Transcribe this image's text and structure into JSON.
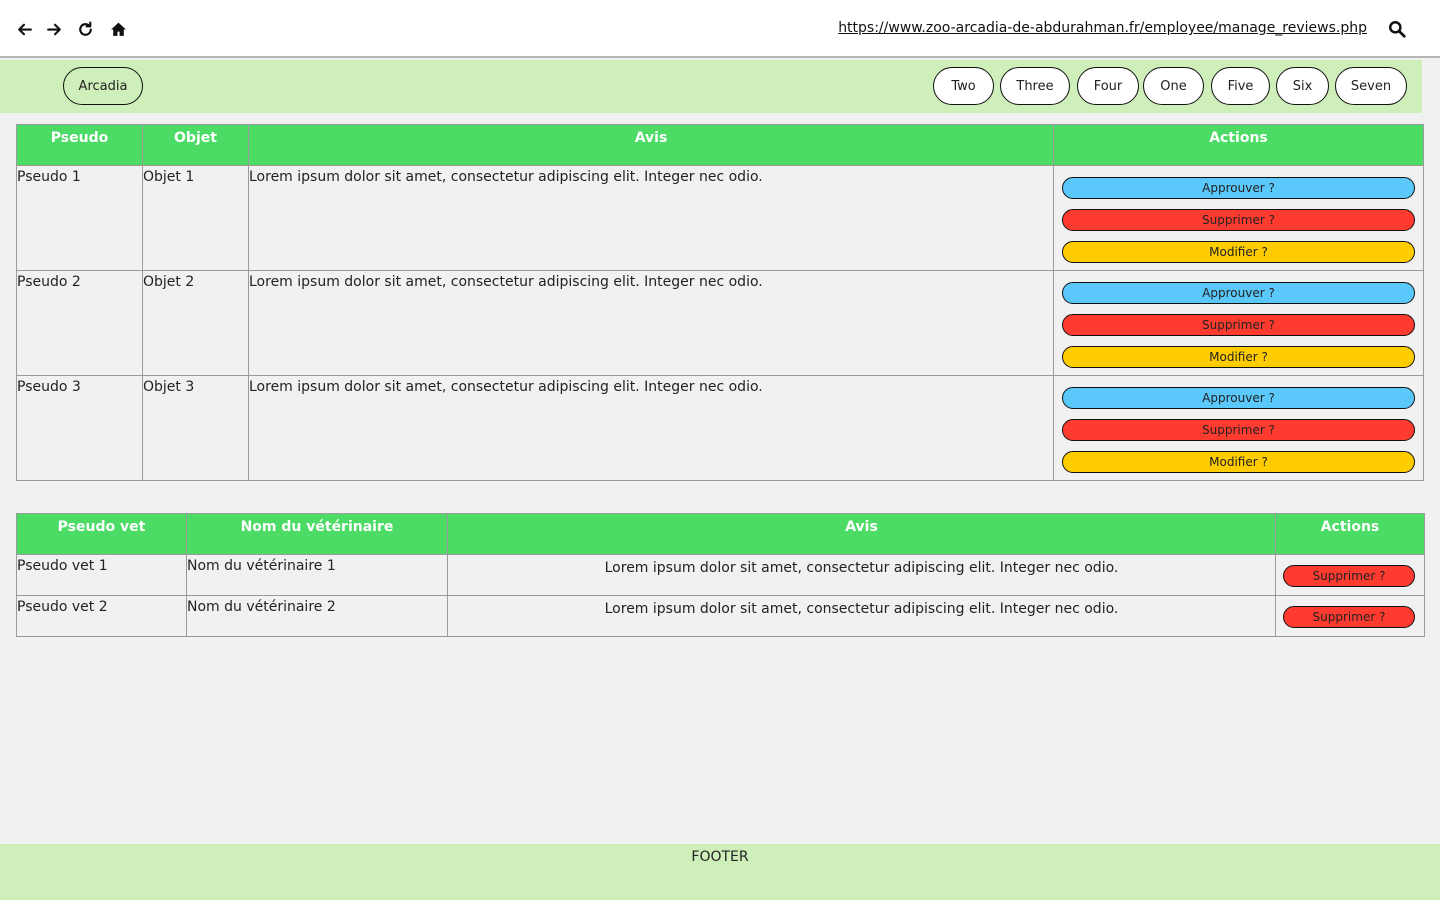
{
  "browser": {
    "url": "https://www.zoo-arcadia-de-abdurahman.fr/employee/manage_reviews.php"
  },
  "header": {
    "brand": "Arcadia",
    "nav": [
      "Two",
      "Three",
      "Four",
      "One",
      "Five",
      "Six",
      "Seven"
    ]
  },
  "reviews_table": {
    "headers": [
      "Pseudo",
      "Objet",
      "Avis",
      "Actions"
    ],
    "rows": [
      {
        "pseudo": "Pseudo 1",
        "objet": "Objet 1",
        "avis": "Lorem ipsum dolor sit amet, consectetur adipiscing elit. Integer nec odio."
      },
      {
        "pseudo": "Pseudo 2",
        "objet": "Objet 2",
        "avis": "Lorem ipsum dolor sit amet, consectetur adipiscing elit. Integer nec odio."
      },
      {
        "pseudo": "Pseudo 3",
        "objet": "Objet 3",
        "avis": "Lorem ipsum dolor sit amet, consectetur adipiscing elit. Integer nec odio."
      }
    ],
    "actions": {
      "approve": "Approuver ?",
      "delete": "Supprimer ?",
      "edit": "Modifier ?"
    }
  },
  "vet_table": {
    "headers": [
      "Pseudo vet",
      "Nom du vétérinaire",
      "Avis",
      "Actions"
    ],
    "rows": [
      {
        "pseudo": "Pseudo vet 1",
        "nom": "Nom du vétérinaire 1",
        "avis": "Lorem ipsum dolor sit amet, consectetur adipiscing elit. Integer nec odio."
      },
      {
        "pseudo": "Pseudo vet 2",
        "nom": "Nom du vétérinaire 2",
        "avis": "Lorem ipsum dolor sit amet, consectetur adipiscing elit. Integer nec odio."
      }
    ],
    "actions": {
      "delete": "Supprimer ?"
    }
  },
  "footer": {
    "text": "FOOTER"
  },
  "colors": {
    "header_bg": "#ceeeba",
    "table_header": "#4cdc66",
    "approve": "#5ac8fa",
    "delete": "#ff3b30",
    "edit": "#ffcc00"
  }
}
